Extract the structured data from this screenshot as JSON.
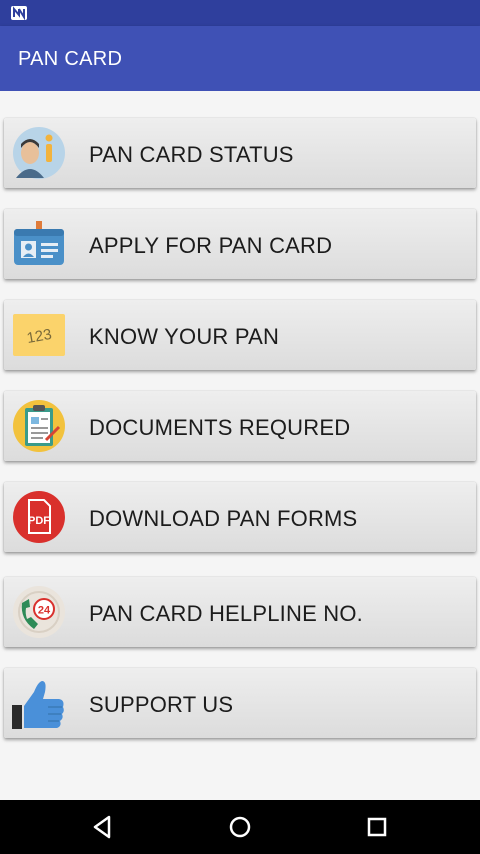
{
  "app": {
    "title": "PAN CARD"
  },
  "menu": [
    {
      "label": "PAN CARD STATUS",
      "icon": "info-person-icon"
    },
    {
      "label": "APPLY FOR PAN CARD",
      "icon": "id-card-icon"
    },
    {
      "label": "KNOW YOUR PAN",
      "icon": "note-123-icon",
      "icon_text": "123"
    },
    {
      "label": "DOCUMENTS REQURED",
      "icon": "clipboard-icon"
    },
    {
      "label": "DOWNLOAD PAN FORMS",
      "icon": "pdf-icon",
      "icon_text": "PDF"
    },
    {
      "label": "PAN CARD HELPLINE NO.",
      "icon": "helpline-24-icon",
      "icon_text": "24"
    },
    {
      "label": "SUPPORT US",
      "icon": "thumbs-up-icon"
    }
  ],
  "colors": {
    "app_bar": "#3f51b5",
    "status_bar": "#2f3f9d",
    "button": "#e4e4e4"
  }
}
